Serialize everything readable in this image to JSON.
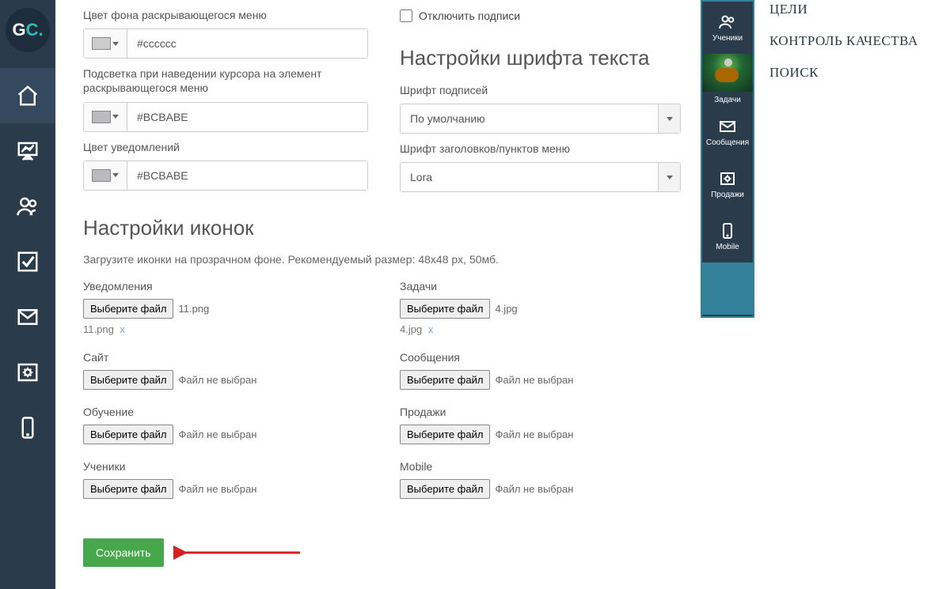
{
  "leftRail": {
    "logo_g": "G",
    "logo_c": "C."
  },
  "colorFields": {
    "menu_bg_label": "Цвет фона раскрывающегося меню",
    "menu_bg_hex": "#cccccc",
    "hover_label": "Подсветка при наведении курсора на элемент раскрывающегося меню",
    "hover_hex": "#BCBABE",
    "notif_label": "Цвет уведомлений",
    "notif_hex": "#BCBABE"
  },
  "right_col": {
    "disable_captions": "Отключить подписи",
    "font_heading": "Настройки шрифта текста",
    "subscript_label": "Шрифт подписей",
    "subscript_value": "По умолчанию",
    "headings_label": "Шрифт заголовков/пунктов меню",
    "headings_value": "Lora"
  },
  "icons_section": {
    "heading": "Настройки иконок",
    "hint": "Загрузите иконки на прозрачном фоне. Рекомендуемый размер: 48x48 px, 50мб."
  },
  "uploads": {
    "file_btn": "Выберите файл",
    "no_file": "Файл не выбран",
    "notif_label": "Уведомления",
    "notif_file": "11.png",
    "notif_line": "11.png",
    "site_label": "Сайт",
    "trainings_label": "Обучение",
    "students_label": "Ученики",
    "tasks_label": "Задачи",
    "tasks_file": "4.jpg",
    "tasks_line": "4.jpg",
    "messages_label": "Сообщения",
    "sales_label": "Продажи",
    "mobile_label": "Mobile",
    "remove_x": "x"
  },
  "save": {
    "btn": "Сохранить"
  },
  "rightRail": {
    "students": "Ученики",
    "tasks": "Задачи",
    "messages": "Сообщения",
    "sales": "Продажи",
    "mobile": "Mobile"
  },
  "rightLinks": {
    "goals": "ЦЕЛИ",
    "quality": "КОНТРОЛЬ КАЧЕСТВА",
    "search": "ПОИСК"
  }
}
